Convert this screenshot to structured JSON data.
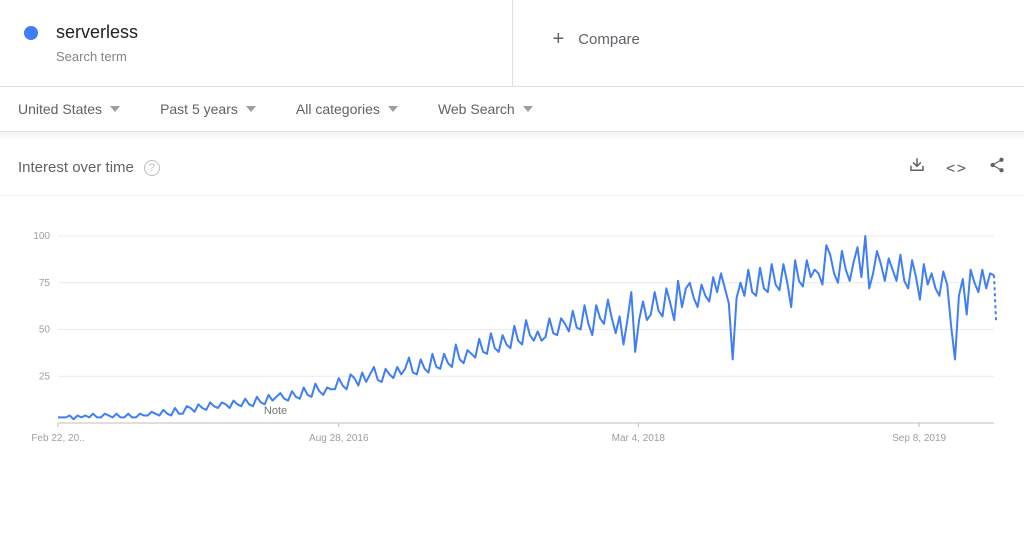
{
  "search": {
    "term": "serverless",
    "subtype": "Search term",
    "color": "#3f7ef4"
  },
  "compare_label": "Compare",
  "filters": {
    "region": "United States",
    "time": "Past 5 years",
    "category": "All categories",
    "type": "Web Search"
  },
  "section_title": "Interest over time",
  "note_label": "Note",
  "icon_names": {
    "download": "download-icon",
    "embed": "embed-icon",
    "share": "share-icon",
    "help": "help-icon"
  },
  "dotted_tail": [
    79,
    55
  ],
  "chart_data": {
    "type": "line",
    "title": "Interest over time",
    "categories": [
      "Feb 22, 20..",
      "Aug 28, 2016",
      "Mar 4, 2018",
      "Sep 8, 2019"
    ],
    "y_ticks": [
      25,
      50,
      75,
      100
    ],
    "ylim": [
      0,
      100
    ],
    "series": [
      {
        "name": "serverless",
        "color": "#3f7ef4",
        "values": [
          3,
          3,
          3,
          4,
          2,
          4,
          3,
          4,
          3,
          5,
          3,
          3,
          5,
          4,
          3,
          5,
          3,
          3,
          5,
          3,
          3,
          5,
          4,
          4,
          6,
          5,
          4,
          7,
          5,
          4,
          8,
          5,
          5,
          9,
          8,
          6,
          10,
          8,
          7,
          11,
          9,
          8,
          11,
          10,
          8,
          12,
          10,
          9,
          13,
          10,
          9,
          14,
          11,
          10,
          15,
          12,
          14,
          16,
          13,
          12,
          17,
          14,
          13,
          19,
          15,
          14,
          21,
          17,
          15,
          19,
          18,
          18,
          24,
          20,
          18,
          26,
          24,
          20,
          27,
          22,
          26,
          30,
          23,
          22,
          29,
          26,
          24,
          30,
          26,
          29,
          35,
          27,
          26,
          34,
          29,
          27,
          37,
          30,
          29,
          37,
          32,
          30,
          42,
          34,
          32,
          39,
          37,
          35,
          45,
          38,
          37,
          48,
          40,
          38,
          47,
          42,
          40,
          52,
          44,
          42,
          55,
          47,
          44,
          49,
          44,
          46,
          56,
          48,
          47,
          56,
          53,
          49,
          60,
          51,
          50,
          63,
          53,
          47,
          63,
          56,
          53,
          66,
          56,
          48,
          57,
          42,
          55,
          70,
          38,
          55,
          65,
          55,
          58,
          70,
          60,
          57,
          72,
          64,
          55,
          76,
          62,
          72,
          75,
          67,
          62,
          74,
          68,
          65,
          78,
          70,
          80,
          72,
          64,
          34,
          67,
          75,
          68,
          82,
          70,
          68,
          83,
          72,
          70,
          85,
          74,
          71,
          85,
          75,
          62,
          87,
          76,
          73,
          87,
          78,
          82,
          80,
          74,
          95,
          90,
          80,
          75,
          92,
          82,
          76,
          86,
          94,
          78,
          100,
          72,
          80,
          92,
          85,
          76,
          88,
          82,
          76,
          90,
          76,
          72,
          87,
          78,
          66,
          85,
          74,
          80,
          72,
          68,
          81,
          74,
          52,
          34,
          68,
          77,
          58,
          82,
          75,
          70,
          82,
          72,
          80,
          79
        ]
      }
    ]
  }
}
